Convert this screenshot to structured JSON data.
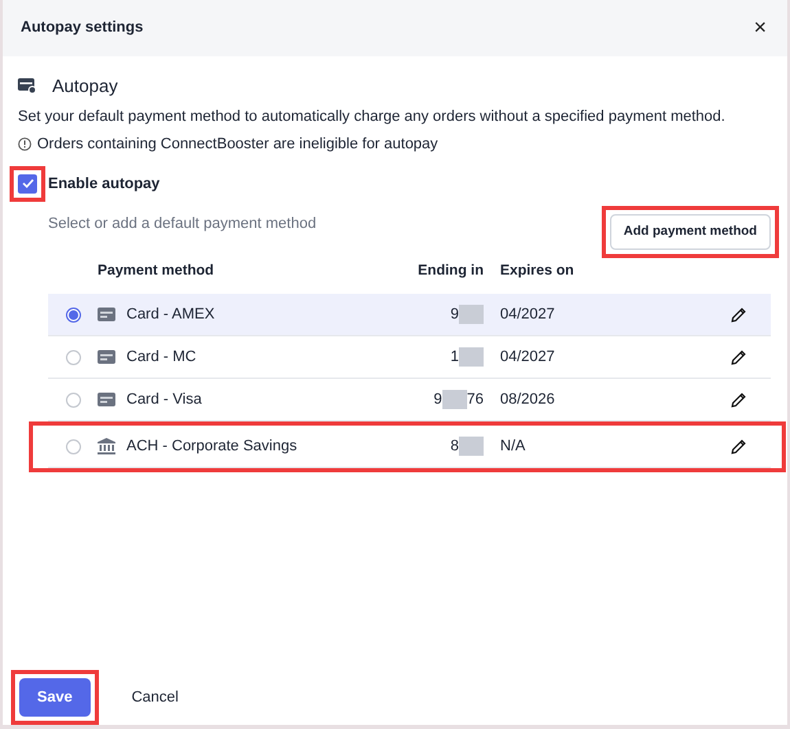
{
  "dialog": {
    "title": "Autopay settings",
    "close": "×"
  },
  "section": {
    "title": "Autopay",
    "description": "Set your default payment method to automatically charge any orders without a specified payment method.",
    "notice": "Orders containing ConnectBooster are ineligible for autopay"
  },
  "enable_autopay": {
    "label": "Enable autopay",
    "checked": true,
    "highlighted": true
  },
  "hint": "Select or add a default payment method",
  "add_button": {
    "label": "Add payment method",
    "highlighted": true
  },
  "table": {
    "columns": [
      "Payment method",
      "Ending in",
      "Expires on"
    ],
    "rows": [
      {
        "kind": "card",
        "name": "Card - AMEX",
        "ending_lead": "9",
        "ending_tail": "",
        "expires": "04/2027",
        "selected": true,
        "highlighted": false
      },
      {
        "kind": "card",
        "name": "Card - MC",
        "ending_lead": "1",
        "ending_tail": "",
        "expires": "04/2027",
        "selected": false,
        "highlighted": false
      },
      {
        "kind": "card",
        "name": "Card - Visa",
        "ending_lead": "9",
        "ending_tail": "76",
        "expires": "08/2026",
        "selected": false,
        "highlighted": false
      },
      {
        "kind": "bank",
        "name": "ACH - Corporate Savings",
        "ending_lead": "8",
        "ending_tail": "",
        "expires": "N/A",
        "selected": false,
        "highlighted": true
      }
    ]
  },
  "footer": {
    "save": {
      "label": "Save",
      "highlighted": true
    },
    "cancel": "Cancel"
  }
}
